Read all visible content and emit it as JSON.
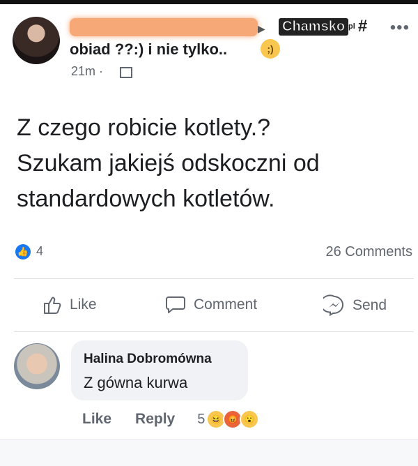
{
  "post": {
    "group_name": "obiad ??:) i nie tylko..",
    "timestamp": "21m ·",
    "watermark": "Chamsko",
    "watermark_suffix": "pl",
    "text_lines": [
      "Z czego robicie kotlety.?",
      "Szukam jakiejś odskoczni od",
      "standardowych kotletów."
    ]
  },
  "stats": {
    "likes": "4",
    "comments": "26 Comments"
  },
  "actions": {
    "like": "Like",
    "comment": "Comment",
    "send": "Send"
  },
  "comment": {
    "author": "Halina Dobromówna",
    "text": "Z gówna kurwa",
    "like_label": "Like",
    "reply_label": "Reply",
    "reaction_count": "5"
  },
  "colors": {
    "accent": "#1877f2",
    "redaction": "#f7a877",
    "text_secondary": "#606770"
  },
  "icons": [
    "more-icon",
    "group-icon",
    "like-icon",
    "comment-icon",
    "messenger-icon",
    "haha-reaction",
    "angry-reaction",
    "wow-reaction",
    "wink-emoji"
  ]
}
